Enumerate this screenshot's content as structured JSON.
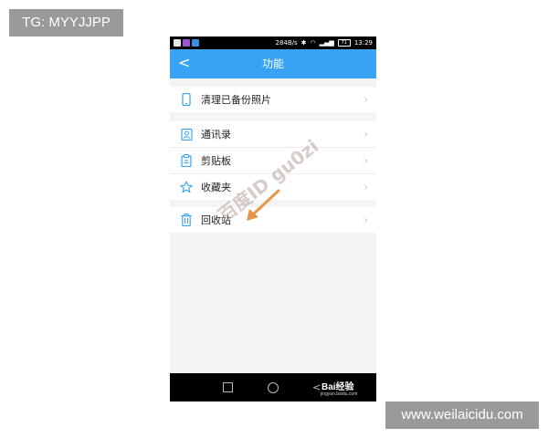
{
  "watermarks": {
    "top_left_tag": "TG: MYYJJPP",
    "bottom_right_tag": "www.weilaicidu.com",
    "diagonal": "百度ID gu0zi",
    "baidu_logo": "Bai经验",
    "baidu_url": "jingyan.baidu.com"
  },
  "statusbar": {
    "speed": "284B/s",
    "battery": "71",
    "time": "13:29"
  },
  "titlebar": {
    "back_glyph": "<",
    "title": "功能"
  },
  "groups": [
    {
      "items": [
        {
          "label": "清理已备份照片",
          "icon": "phone-icon"
        }
      ]
    },
    {
      "items": [
        {
          "label": "通讯录",
          "icon": "contacts-icon"
        },
        {
          "label": "剪贴板",
          "icon": "clipboard-icon"
        },
        {
          "label": "收藏夹",
          "icon": "star-icon"
        }
      ]
    },
    {
      "items": [
        {
          "label": "回收站",
          "icon": "trash-icon"
        }
      ]
    }
  ],
  "chevron": "›",
  "colors": {
    "accent": "#39a3f3",
    "background": "#f4f4f6",
    "arrow": "#e8954a"
  }
}
